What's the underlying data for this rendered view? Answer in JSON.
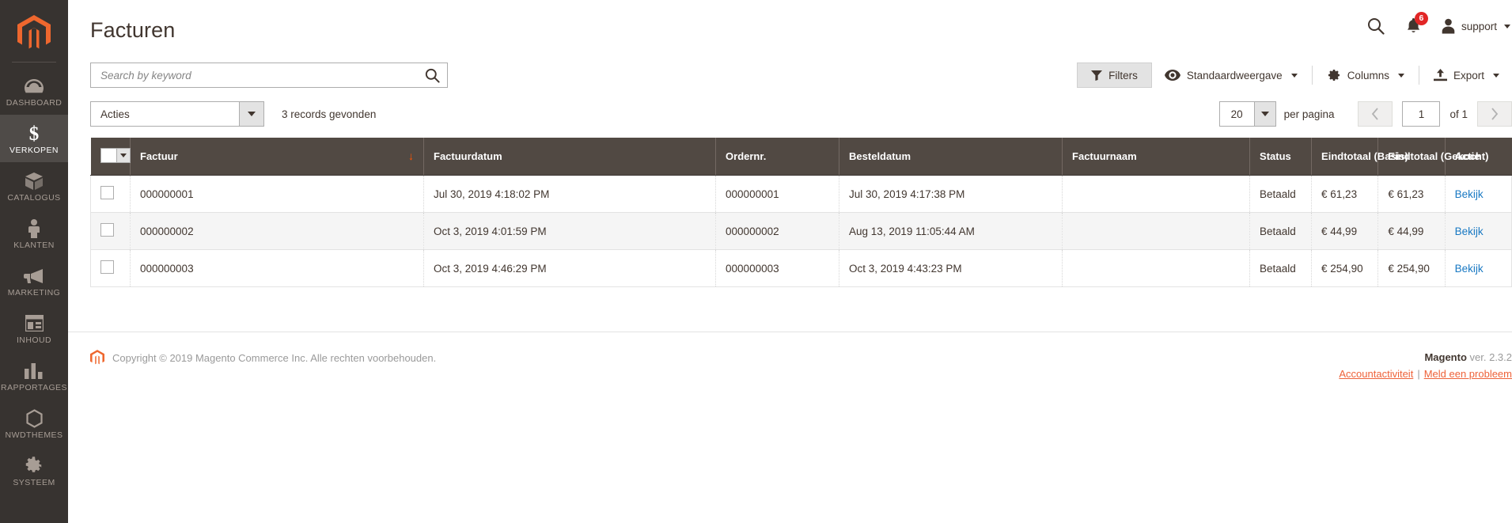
{
  "sidebar": {
    "logo_alt": "magento-logo",
    "items": [
      {
        "label": "DASHBOARD",
        "icon": "dashboard-icon",
        "active": false
      },
      {
        "label": "VERKOPEN",
        "icon": "sales-dollar-icon",
        "active": true
      },
      {
        "label": "CATALOGUS",
        "icon": "catalog-box-icon",
        "active": false
      },
      {
        "label": "KLANTEN",
        "icon": "customers-person-icon",
        "active": false
      },
      {
        "label": "MARKETING",
        "icon": "marketing-megaphone-icon",
        "active": false
      },
      {
        "label": "INHOUD",
        "icon": "content-layout-icon",
        "active": false
      },
      {
        "label": "RAPPORTAGES",
        "icon": "reports-bars-icon",
        "active": false
      },
      {
        "label": "NWDTHEMES",
        "icon": "hexagon-icon",
        "active": false
      },
      {
        "label": "SYSTEEM",
        "icon": "system-gear-icon",
        "active": false
      }
    ]
  },
  "header": {
    "title": "Facturen",
    "search_icon": "search-icon",
    "notifications_icon": "bell-icon",
    "notifications_count": "6",
    "user_icon": "user-avatar-icon",
    "user_name": "support"
  },
  "search": {
    "value": "",
    "placeholder": "Search by keyword",
    "icon": "search-icon"
  },
  "toolbar": {
    "filters_label": "Filters",
    "filters_icon": "funnel-icon",
    "view_label": "Standaardweergave",
    "view_icon": "eye-icon",
    "columns_label": "Columns",
    "columns_icon": "gear-icon",
    "export_label": "Export",
    "export_icon": "upload-icon"
  },
  "admin_bar": {
    "actions_label": "Acties",
    "records_found": "3 records gevonden",
    "per_page_value": "20",
    "per_page_label": "per pagina",
    "prev_icon": "chevron-left-icon",
    "next_icon": "chevron-right-icon",
    "page_value": "1",
    "of_label": "of 1"
  },
  "grid": {
    "sort_column": "Factuur",
    "sort_direction": "desc",
    "sort_arrow": "↓",
    "columns": [
      "Factuur",
      "Factuurdatum",
      "Ordernr.",
      "Besteldatum",
      "Factuurnaam",
      "Status",
      "Eindtotaal (Basis)",
      "Eindtotaal (Gekocht)",
      "Actie"
    ],
    "rows": [
      {
        "factuur": "000000001",
        "factuurdatum": "Jul 30, 2019 4:18:02 PM",
        "ordernr": "000000001",
        "besteldatum": "Jul 30, 2019 4:17:38 PM",
        "factuurnaam": "",
        "status": "Betaald",
        "eindtotaal_basis": "€ 61,23",
        "eindtotaal_gekocht": "€ 61,23",
        "actie": "Bekijk"
      },
      {
        "factuur": "000000002",
        "factuurdatum": "Oct 3, 2019 4:01:59 PM",
        "ordernr": "000000002",
        "besteldatum": "Aug 13, 2019 11:05:44 AM",
        "factuurnaam": "",
        "status": "Betaald",
        "eindtotaal_basis": "€ 44,99",
        "eindtotaal_gekocht": "€ 44,99",
        "actie": "Bekijk"
      },
      {
        "factuur": "000000003",
        "factuurdatum": "Oct 3, 2019 4:46:29 PM",
        "ordernr": "000000003",
        "besteldatum": "Oct 3, 2019 4:43:23 PM",
        "factuurnaam": "",
        "status": "Betaald",
        "eindtotaal_basis": "€ 254,90",
        "eindtotaal_gekocht": "€ 254,90",
        "actie": "Bekijk"
      }
    ]
  },
  "footer": {
    "copyright": "Copyright © 2019 Magento Commerce Inc. Alle rechten voorbehouden.",
    "brand": "Magento",
    "version": " ver. 2.3.2",
    "link_activity": "Accountactiviteit",
    "link_report": "Meld een probleem"
  },
  "colors": {
    "sidebar_bg": "#373330",
    "sidebar_active": "#4f4b48",
    "brand_orange": "#ee672e",
    "table_header_bg": "#514943",
    "link_blue": "#1979c3",
    "accent_sort": "#ff5501",
    "badge_red": "#e22626"
  }
}
